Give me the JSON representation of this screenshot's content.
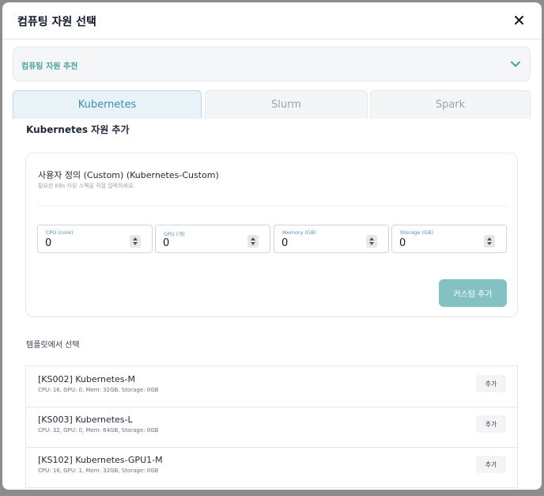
{
  "modal": {
    "title": "컴퓨팅 자원 선택",
    "close_icon": "close-icon"
  },
  "accordion": {
    "label": "컴퓨팅 자원 추천",
    "expand_icon": "chevron-down-icon"
  },
  "tabs": [
    {
      "label": "Kubernetes",
      "active": true
    },
    {
      "label": "Slurm",
      "active": false
    },
    {
      "label": "Spark",
      "active": false
    }
  ],
  "section_title": "Kubernetes 자원 추가",
  "custom": {
    "name": "사용자 정의 (Custom) (Kubernetes-Custom)",
    "description": "필요한 K8s 자원 스펙을 직접 입력하세요.",
    "fields": [
      {
        "label": "CPU (core)",
        "value": "0"
      },
      {
        "label": "GPU (개)",
        "value": "0"
      },
      {
        "label": "Memory (GB)",
        "value": "0"
      },
      {
        "label": "Storage (GB)",
        "value": "0"
      }
    ],
    "add_button": "커스텀 추가"
  },
  "templates": {
    "title": "템플릿에서 선택",
    "items": [
      {
        "name": "[KS002] Kubernetes-M",
        "spec": "CPU: 16, GPU: 0, Mem: 32GB, Storage: 0GB",
        "button": "추가"
      },
      {
        "name": "[KS003] Kubernetes-L",
        "spec": "CPU: 32, GPU: 0, Mem: 64GB, Storage: 0GB",
        "button": "추가"
      },
      {
        "name": "[KS102] Kubernetes-GPU1-M",
        "spec": "CPU: 16, GPU: 1, Mem: 32GB, Storage: 0GB",
        "button": "추가"
      }
    ]
  },
  "colors": {
    "accent": "#4b9fa5",
    "primary_button": "#84c1c2",
    "active_tab_bg": "#e8f2f7",
    "active_tab_text": "#3b8fb0"
  }
}
